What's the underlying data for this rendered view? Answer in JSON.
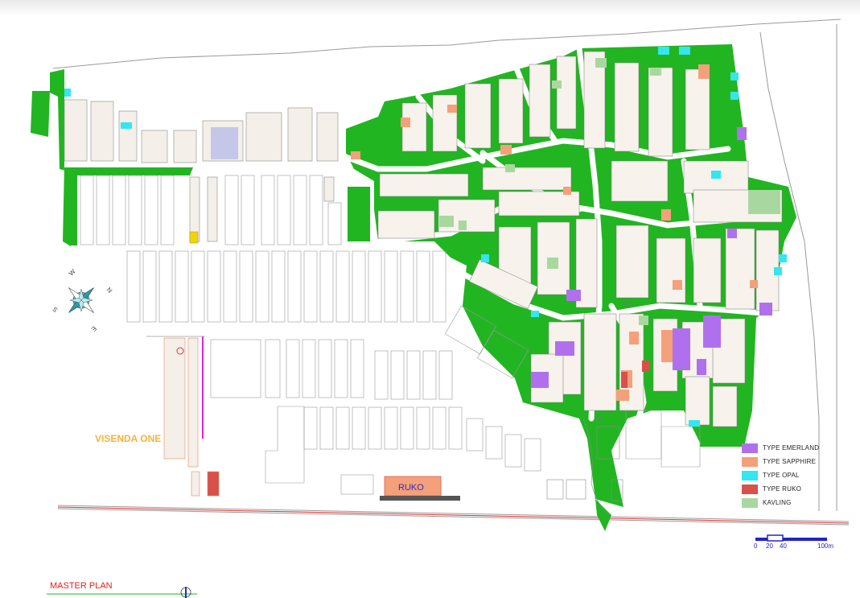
{
  "labels": {
    "visenda": "VISENDA ONE",
    "ruko": "RUKO",
    "master": "MASTER PLAN"
  },
  "compass": {
    "n": "N",
    "s": "S",
    "e": "E",
    "w": "W"
  },
  "legend": [
    {
      "label": "TYPE EMERLAND",
      "color": "#b070ee"
    },
    {
      "label": "TYPE SAPPHIRE",
      "color": "#f4a07a"
    },
    {
      "label": "TYPE OPAL",
      "color": "#33e6f0"
    },
    {
      "label": "TYPE RUKO",
      "color": "#d8504a"
    },
    {
      "label": "KAVLING",
      "color": "#a8d8a0"
    }
  ],
  "scale": {
    "t0": "0",
    "t20": "20",
    "t40": "40",
    "t100": "100m"
  },
  "colors": {
    "green": "#22b522",
    "road": "#ffffff",
    "lot": "#f4efe9",
    "outline": "#9a9a9a",
    "road_line": "#e03030",
    "magenta": "#e020e0"
  }
}
